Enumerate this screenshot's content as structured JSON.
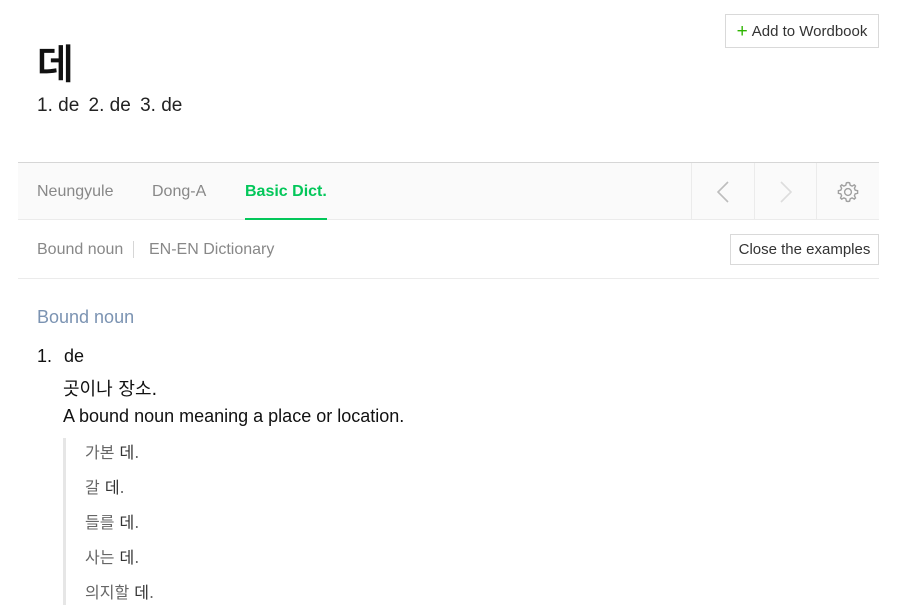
{
  "entry": {
    "headword": "데",
    "pronunciations": [
      "1. de",
      "2. de",
      "3. de"
    ]
  },
  "wordbook_button": {
    "plus": "+",
    "label": "Add to Wordbook"
  },
  "tabs": [
    {
      "label": "Neungyule",
      "active": false
    },
    {
      "label": "Dong-A",
      "active": false
    },
    {
      "label": "Basic Dict.",
      "active": true
    }
  ],
  "nav_icons": [
    "chevron-left-icon",
    "chevron-right-icon",
    "gear-icon"
  ],
  "subbar": {
    "part_of_speech": "Bound noun",
    "dictionary": "EN-EN Dictionary",
    "close_examples_label": "Close the examples"
  },
  "definition": {
    "pos_title": "Bound noun",
    "number": "1.",
    "word": "de",
    "korean": "곳이나 장소.",
    "english": "A bound noun meaning a place or location.",
    "examples": [
      {
        "pre": "가본 ",
        "word": "데",
        "post": "."
      },
      {
        "pre": "갈 ",
        "word": "데",
        "post": "."
      },
      {
        "pre": "들를 ",
        "word": "데",
        "post": "."
      },
      {
        "pre": "사는 ",
        "word": "데",
        "post": "."
      },
      {
        "pre": "의지할 ",
        "word": "데",
        "post": "."
      }
    ]
  },
  "colors": {
    "accent_green": "#03c75a",
    "pos_blue": "#7b93b2"
  }
}
